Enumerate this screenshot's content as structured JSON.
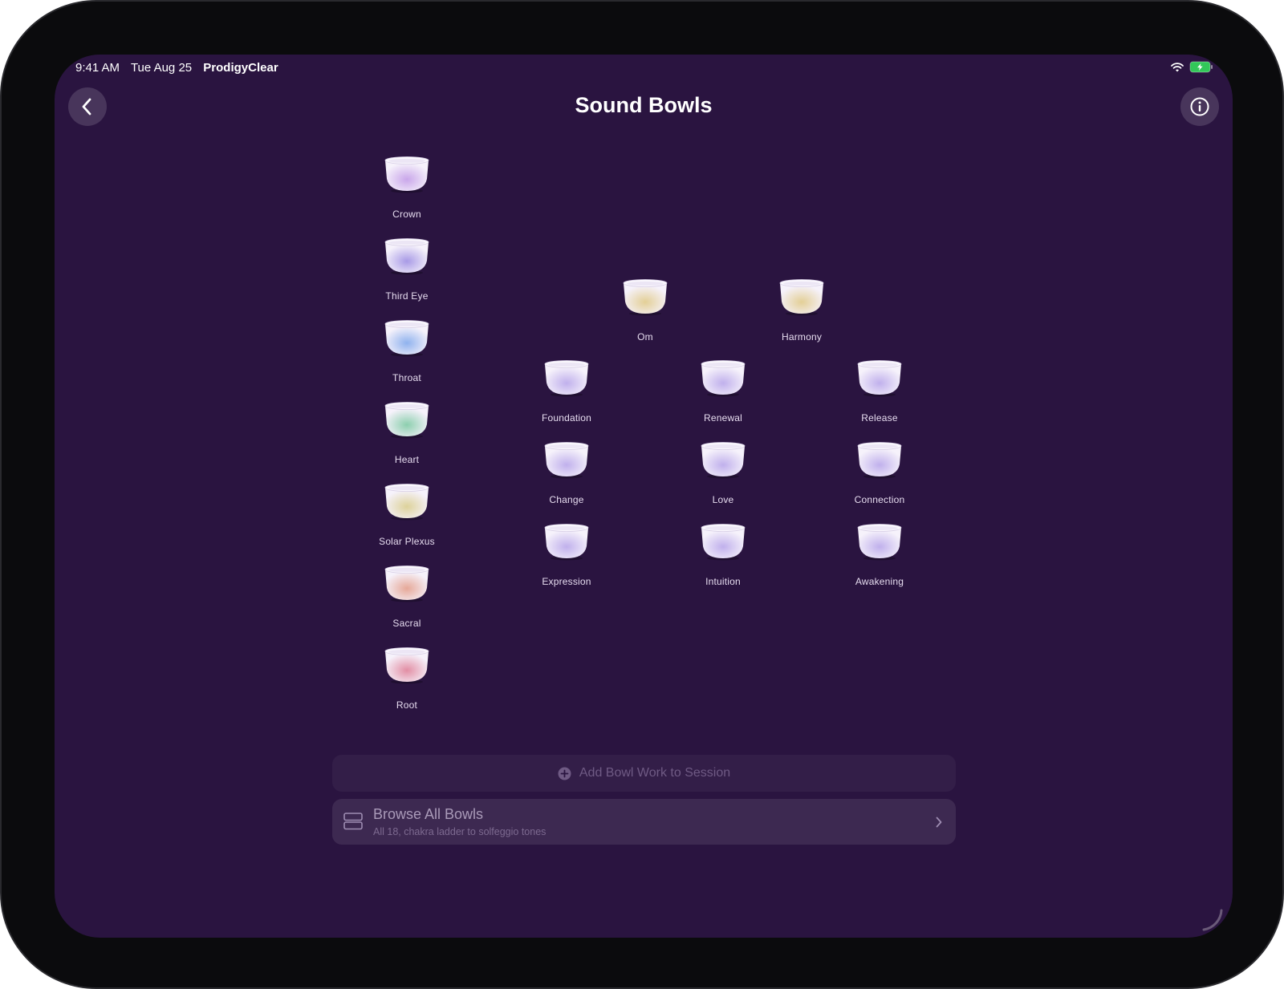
{
  "status": {
    "time": "9:41 AM",
    "date": "Tue Aug 25",
    "carrier": "ProdigyClear",
    "icons": [
      "wifi-icon",
      "battery-charging-icon"
    ]
  },
  "header": {
    "title": "Sound Bowls",
    "back_icon": "chevron-left-icon",
    "info_icon": "info-icon"
  },
  "chakra_bowls": [
    {
      "label": "Crown",
      "tint": "#c9a6ea"
    },
    {
      "label": "Third Eye",
      "tint": "#a89ae6"
    },
    {
      "label": "Throat",
      "tint": "#8fb2ee"
    },
    {
      "label": "Heart",
      "tint": "#8ccfae"
    },
    {
      "label": "Solar Plexus",
      "tint": "#ddd29a"
    },
    {
      "label": "Sacral",
      "tint": "#e6a898"
    },
    {
      "label": "Root",
      "tint": "#e28ea4"
    }
  ],
  "golden_bowls": [
    {
      "label": "Om",
      "tint": "#e3cf96"
    },
    {
      "label": "Harmony",
      "tint": "#e3cf96"
    }
  ],
  "solfeggio_bowls": [
    {
      "label": "Foundation",
      "tint": "#c0b0ec"
    },
    {
      "label": "Renewal",
      "tint": "#c0b0ec"
    },
    {
      "label": "Release",
      "tint": "#c0b0ec"
    },
    {
      "label": "Change",
      "tint": "#c0b0ec"
    },
    {
      "label": "Love",
      "tint": "#c0b0ec"
    },
    {
      "label": "Connection",
      "tint": "#c0b0ec"
    },
    {
      "label": "Expression",
      "tint": "#c0b0ec"
    },
    {
      "label": "Intuition",
      "tint": "#c0b0ec"
    },
    {
      "label": "Awakening",
      "tint": "#c0b0ec"
    }
  ],
  "actions": {
    "add_label": "Add Bowl Work to Session",
    "add_icon": "plus-circle-icon",
    "browse_title": "Browse All Bowls",
    "browse_subtitle": "All 18, chakra ladder to solfeggio tones",
    "browse_icon": "stack-icon",
    "browse_chevron": "chevron-right-icon"
  },
  "colors": {
    "background": "#2a1440",
    "text": "#ffffff"
  }
}
